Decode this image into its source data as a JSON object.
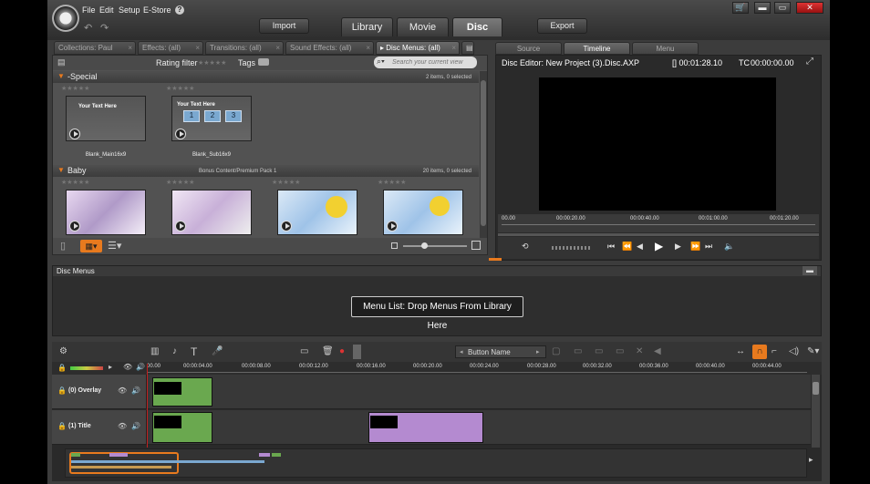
{
  "menubar": {
    "file": "File",
    "edit": "Edit",
    "setup": "Setup",
    "estore": "E-Store",
    "help": "?"
  },
  "header": {
    "import": "Import",
    "export": "Export",
    "tabs": [
      "Library",
      "Movie",
      "Disc"
    ],
    "active_tab": "Disc"
  },
  "library": {
    "tabs": [
      "Collections: Paul",
      "Effects: (all)",
      "Transitions: (all)",
      "Sound Effects: (all)",
      "Disc Menus: (all)"
    ],
    "rating_filter": "Rating filter",
    "tags": "Tags",
    "search_placeholder": "Search your current view",
    "groups": [
      {
        "name": "-Special",
        "count": "2 items, 0 selected",
        "items": [
          {
            "caption": "Blank_Main16x9",
            "text": "Your Text Here"
          },
          {
            "caption": "Blank_Sub16x9",
            "text": "Your Text Here",
            "buttons": [
              "1",
              "2",
              "3"
            ]
          }
        ]
      },
      {
        "name": "Baby",
        "subtitle": "Bonus Content/Premium Pack 1",
        "count": "20 items, 0 selected"
      }
    ]
  },
  "preview": {
    "tabs": [
      "Source",
      "Timeline",
      "Menu"
    ],
    "active_tab": "Timeline",
    "title": "Disc Editor: New Project (3).Disc.AXP",
    "duration": "[] 00:01:28.10",
    "tc_label": "TC",
    "tc": "00:00:00.00",
    "ruler": [
      "00.00",
      "00:00:20.00",
      "00:00:40.00",
      "00:01:00.00",
      "00:01:20.00"
    ]
  },
  "disc_menus": {
    "title": "Disc Menus",
    "drop_text": "Menu List: Drop Menus From Library Here"
  },
  "timeline": {
    "button_name": "Button Name",
    "ruler": [
      "00.00",
      "00:00:04.00",
      "00:00:08.00",
      "00:00:12.00",
      "00:00:16.00",
      "00:00:20.00",
      "00:00:24.00",
      "00:00:28.00",
      "00:00:32.00",
      "00:00:36.00",
      "00:00:40.00",
      "00:00:44.00"
    ],
    "tracks": [
      {
        "name": "(0) Overlay"
      },
      {
        "name": "(1) Title"
      }
    ]
  },
  "colors": {
    "accent": "#e87a1e",
    "clip_green": "#6aa84f",
    "clip_purple": "#b48ad0",
    "playhead": "#c02020"
  }
}
